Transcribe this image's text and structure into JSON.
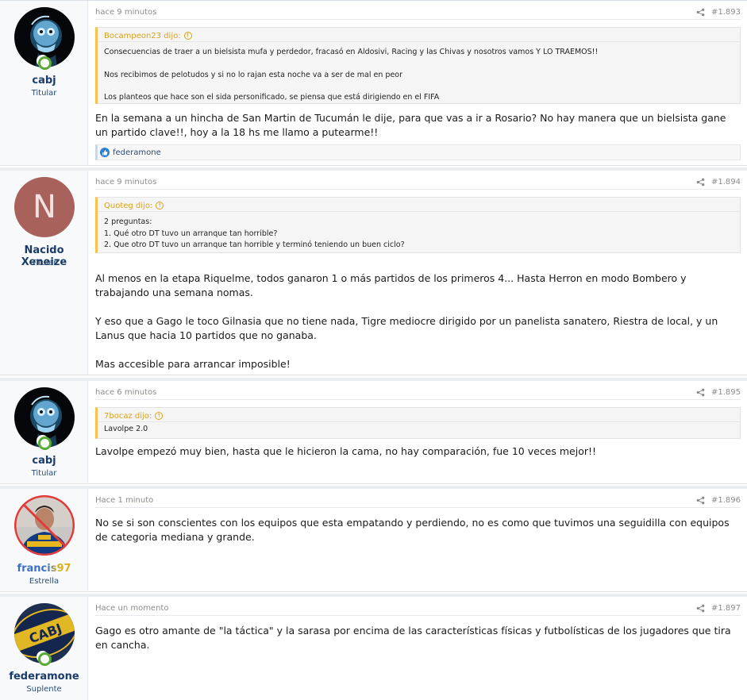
{
  "posts": [
    {
      "user": {
        "name": "cabj",
        "title": "Titular",
        "avatar": "xray-skull-avatar"
      },
      "time": "hace 9 minutos",
      "number": "#1.893",
      "quote": {
        "author": "Bocampeon23 dijo:",
        "lines": [
          "Consecuencias de traer a un bielsista mufa y perdedor, fracasó en Aldosivi, Racing y las Chivas y nosotros vamos Y LO TRAEMOS!!",
          "Nos recibimos de pelotudos y si no lo rajan esta noche va a ser de mal en peor",
          "Los planteos que hace son el sida personificado, se piensa que está dirigiendo en el FIFA"
        ]
      },
      "message": [
        "En la semana a un hincha de San Martin de Tucumán le dije, para que vas a ir a Rosario? No hay manera que un bielsista gane un partido clave!!, hoy a la 18 hs me llamo a putearme!!"
      ],
      "reaction": "federamone"
    },
    {
      "user": {
        "name": "Nacido Xeneize",
        "title": "Titular",
        "avatar_letter": "N"
      },
      "time": "hace 9 minutos",
      "number": "#1.894",
      "quote": {
        "author": "Quoteg dijo:",
        "lines": [
          "2 preguntas:\n1. Qué otro DT tuvo un arranque tan horrible?\n2. Que otro DT tuvo un arranque tan horrible y terminó teniendo un buen ciclo?"
        ]
      },
      "message": [
        "Al menos en la etapa Riquelme, todos ganaron 1 o más partidos de los primeros 4... Hasta Herron en modo Bombero y trabajando una semana nomas.",
        "Y eso que a Gago le toco Gilnasia que no tiene nada, Tigre mediocre dirigido por un panelista sanatero, Riestra de local, y un Lanus que hacia 10 partidos que no ganaba.",
        "Mas accesible para arrancar imposible!"
      ]
    },
    {
      "user": {
        "name": "cabj",
        "title": "Titular",
        "avatar": "xray-skull-avatar"
      },
      "time": "hace 6 minutos",
      "number": "#1.895",
      "quote": {
        "author": "7bocaz dijo:",
        "lines": [
          "Lavolpe 2.0"
        ]
      },
      "message": [
        "Lavolpe empezó muy bien, hasta que le hicieron la cama, no hay comparación, fue 10 veces mejor!!"
      ]
    },
    {
      "user": {
        "name": "francis97",
        "title": "Estrella",
        "avatar": "player-photo-avatar"
      },
      "time": "Hace 1 minuto",
      "number": "#1.896",
      "message": [
        "No se si son conscientes con los equipos que esta empatando y perdiendo, no es como que tuvimos una seguidilla con equipos de categoria mediana y grande."
      ]
    },
    {
      "user": {
        "name": "federamone",
        "title": "Suplente",
        "avatar": "cabj-badge-avatar"
      },
      "time": "Hace un momento",
      "number": "#1.897",
      "message": [
        "Gago es otro amante de \"la táctica\" y la sarasa por encima de las características físicas y futbolísticas de los jugadores que tira en cancha."
      ]
    }
  ],
  "colors": {
    "username": "#1b3c6a",
    "quote_accent": "#f6c14d",
    "online": "#5aa935",
    "francis_gradient": [
      "#3b6fc4",
      "#d9b21c"
    ]
  }
}
